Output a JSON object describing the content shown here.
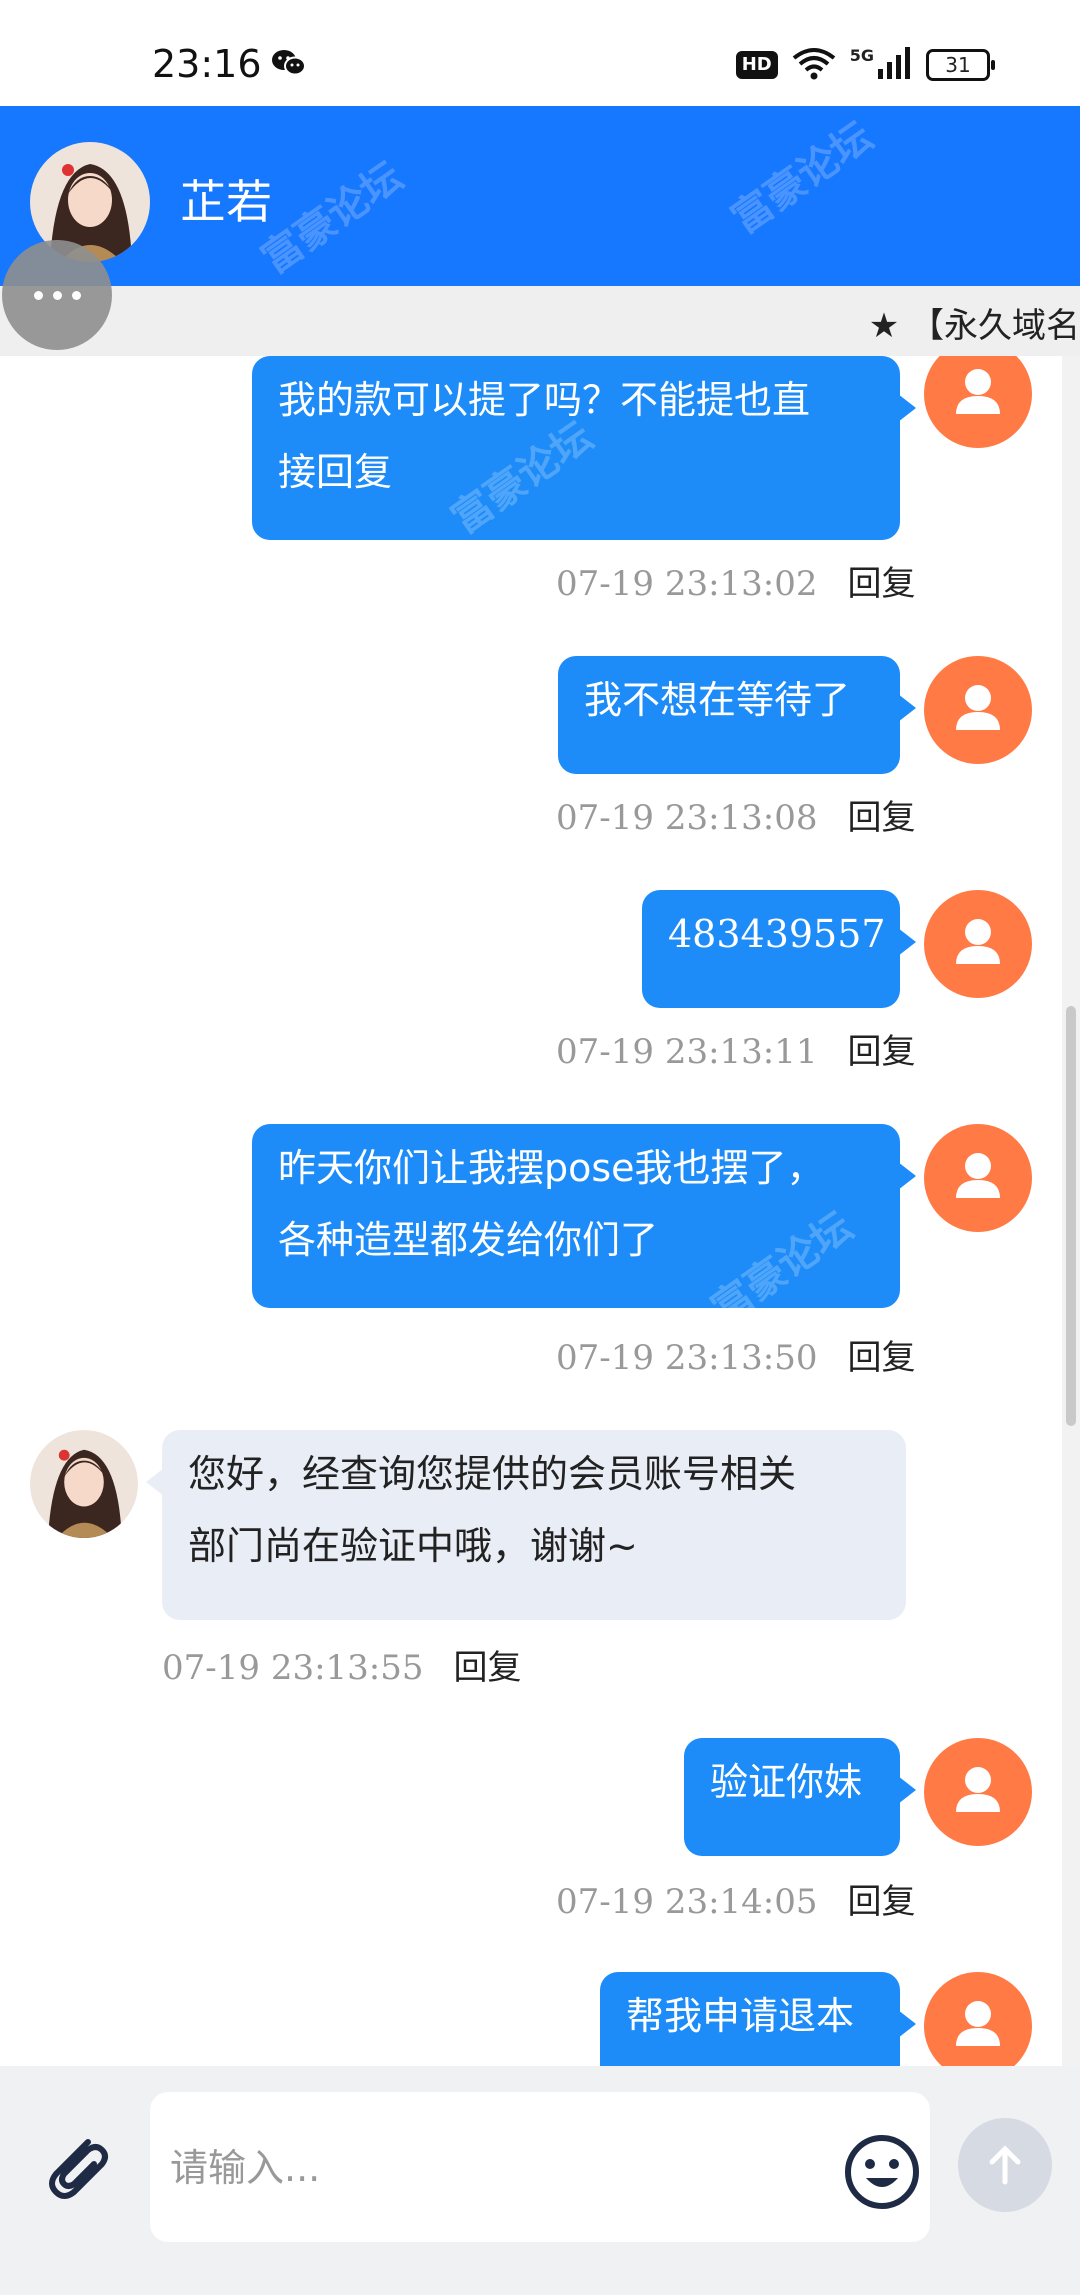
{
  "status_bar": {
    "time": "23:16",
    "network_label": "5G",
    "hd_label": "HD",
    "battery": "31"
  },
  "header": {
    "contact_name": "芷若"
  },
  "marquee": {
    "text": "★ 【永久域名"
  },
  "messages": [
    {
      "direction": "out",
      "text_lines": [
        "我的款可以提了吗？不能提也直",
        "接回复"
      ],
      "timestamp": "07-19 23:13:02",
      "reply_label": "回复"
    },
    {
      "direction": "out",
      "text_lines": [
        "我不想在等待了"
      ],
      "timestamp": "07-19 23:13:08",
      "reply_label": "回复"
    },
    {
      "direction": "out",
      "text_lines": [
        "483439557"
      ],
      "timestamp": "07-19 23:13:11",
      "reply_label": "回复"
    },
    {
      "direction": "out",
      "text_lines": [
        "昨天你们让我摆pose我也摆了，",
        "各种造型都发给你们了"
      ],
      "timestamp": "07-19 23:13:50",
      "reply_label": "回复"
    },
    {
      "direction": "in",
      "text_lines": [
        "您好，经查询您提供的会员账号相关",
        "部门尚在验证中哦，谢谢~"
      ],
      "timestamp": "07-19 23:13:55",
      "reply_label": "回复"
    },
    {
      "direction": "out",
      "text_lines": [
        "验证你妹"
      ],
      "timestamp": "07-19 23:14:05",
      "reply_label": "回复"
    },
    {
      "direction": "out",
      "text_lines": [
        "帮我申请退本"
      ],
      "timestamp": "",
      "reply_label": ""
    }
  ],
  "input": {
    "placeholder": "请输入..."
  },
  "icons": {
    "wechat": "wechat-icon",
    "wifi": "wifi-icon",
    "signal": "signal-icon",
    "more": "more-icon",
    "user_avatar": "user-avatar-icon",
    "attach": "paperclip-icon",
    "emoji": "smiley-icon",
    "send": "arrow-up-icon"
  },
  "colors": {
    "header_bg": "#1677ff",
    "outgoing_bubble": "#1d8cf8",
    "incoming_bubble": "#e9edf5",
    "user_avatar": "#ff7a45"
  }
}
